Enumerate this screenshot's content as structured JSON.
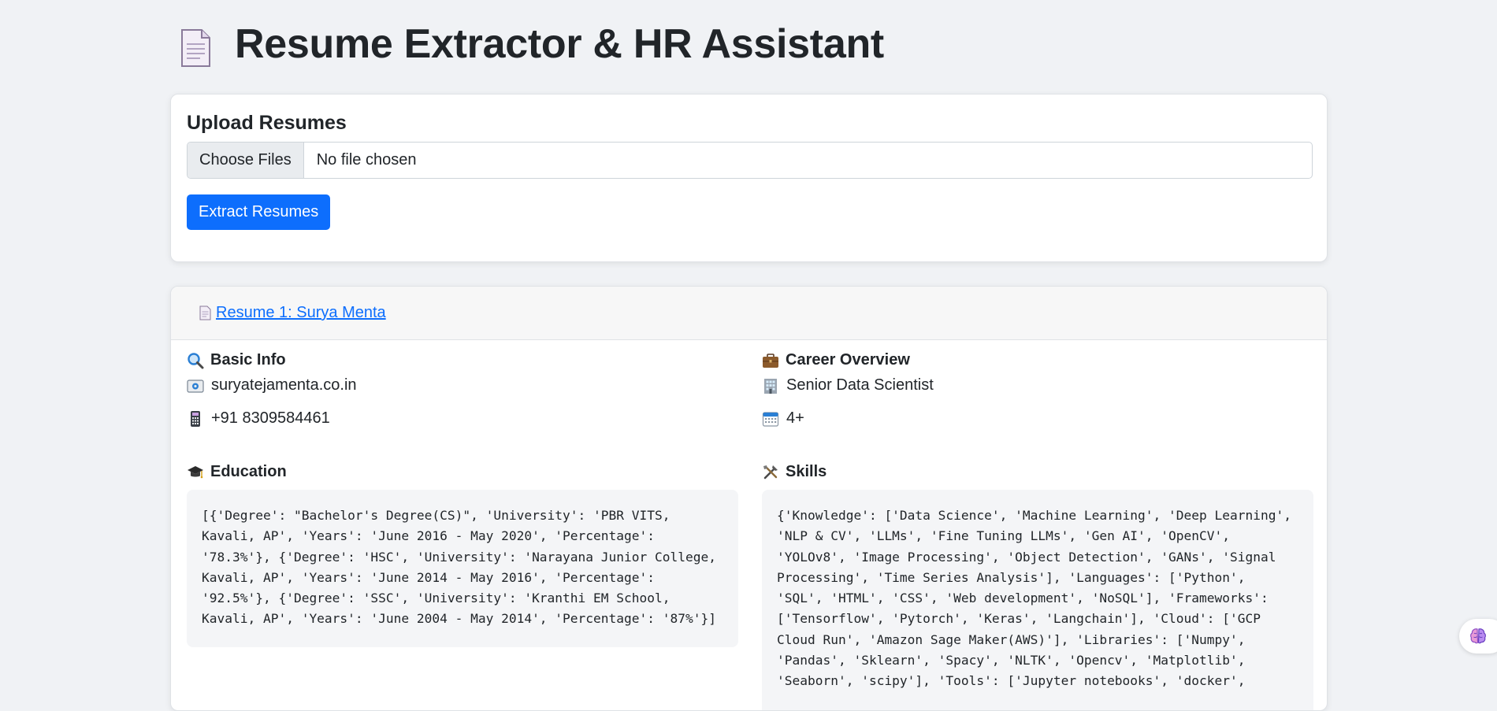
{
  "header": {
    "title": "Resume Extractor & HR Assistant",
    "icon": "document-icon"
  },
  "upload": {
    "heading": "Upload Resumes",
    "choose_files_label": "Choose Files",
    "file_status": "No file chosen",
    "extract_button_label": "Extract Resumes"
  },
  "resume": {
    "link_label": "Resume 1: Surya Menta",
    "basic_info": {
      "heading": "Basic Info",
      "email": "suryatejamenta.co.in",
      "phone": "+91 8309584461"
    },
    "career": {
      "heading": "Career Overview",
      "role": "Senior Data Scientist",
      "experience": "4+"
    },
    "education": {
      "heading": "Education",
      "content": "[{'Degree': \"Bachelor's Degree(CS)\", 'University': 'PBR VITS, Kavali, AP', 'Years': 'June 2016 - May 2020', 'Percentage': '78.3%'}, {'Degree': 'HSC', 'University': 'Narayana Junior College, Kavali, AP', 'Years': 'June 2014 - May 2016', 'Percentage': '92.5%'}, {'Degree': 'SSC', 'University': 'Kranthi EM School, Kavali, AP', 'Years': 'June 2004 - May 2014', 'Percentage': '87%'}]"
    },
    "skills": {
      "heading": "Skills",
      "content": "{'Knowledge': ['Data Science', 'Machine Learning', 'Deep Learning', 'NLP & CV', 'LLMs', 'Fine Tuning LLMs', 'Gen AI', 'OpenCV', 'YOLOv8', 'Image Processing', 'Object Detection', 'GANs', 'Signal Processing', 'Time Series Analysis'], 'Languages': ['Python', 'SQL', 'HTML', 'CSS', 'Web development', 'NoSQL'], 'Frameworks': ['Tensorflow', 'Pytorch', 'Keras', 'Langchain'], 'Cloud': ['GCP Cloud Run', 'Amazon Sage Maker(AWS)'], 'Libraries': ['Numpy', 'Pandas', 'Sklearn', 'Spacy', 'NLTK', 'Opencv', 'Matplotlib', 'Seaborn', 'scipy'], 'Tools': ['Jupyter notebooks', 'docker',"
    }
  },
  "colors": {
    "accent": "#0d6efd",
    "page_background": "#f0f2f5",
    "card_background": "#ffffff",
    "code_background": "#f4f5f7"
  },
  "floating_button": {
    "icon": "brain-icon"
  }
}
